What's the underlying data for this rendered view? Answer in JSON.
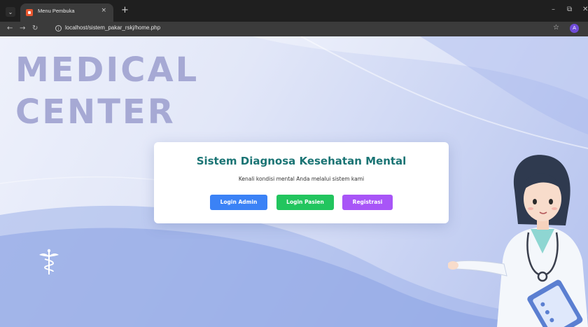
{
  "browser": {
    "tab_title": "Menu Pembuka",
    "tab_close": "×",
    "new_tab": "+",
    "url": "localhost/sistem_pakar_rskj/home.php",
    "profile_initial": "A"
  },
  "hero": {
    "line1": "MEDICAL",
    "line2": "CENTER"
  },
  "card": {
    "title": "Sistem Diagnosa Kesehatan Mental",
    "subtitle": "Kenali kondisi mental Anda melalui sistem kami",
    "buttons": {
      "admin": "Login Admin",
      "pasien": "Login Pasien",
      "registrasi": "Registrasi"
    }
  },
  "colors": {
    "title": "#1a7474",
    "btn_admin": "#3b82f6",
    "btn_pasien": "#22c55e",
    "btn_registrasi": "#a855f7",
    "brand_text": "#a6a9d4"
  },
  "icons": {
    "tab_favicon": "page-favicon-icon",
    "caduceus": "caduceus-icon",
    "star": "bookmark-star-icon"
  }
}
